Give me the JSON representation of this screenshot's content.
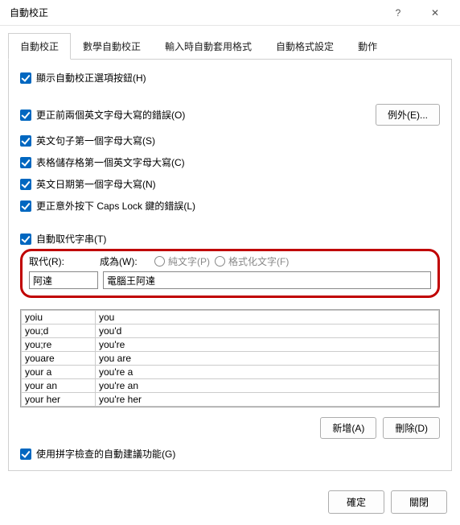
{
  "window": {
    "title": "自動校正",
    "help": "?",
    "close": "✕"
  },
  "tabs": [
    "自動校正",
    "數學自動校正",
    "輸入時自動套用格式",
    "自動格式設定",
    "動作"
  ],
  "checks": {
    "show_buttons": "顯示自動校正選項按鈕(H)",
    "two_caps": "更正前兩個英文字母大寫的錯誤(O)",
    "sentence_cap": "英文句子第一個字母大寫(S)",
    "table_cell_cap": "表格儲存格第一個英文字母大寫(C)",
    "day_cap": "英文日期第一個字母大寫(N)",
    "caps_lock": "更正意外按下 Caps Lock 鍵的錯誤(L)",
    "auto_replace": "自動取代字串(T)",
    "spell_suggest": "使用拼字檢查的自動建議功能(G)"
  },
  "exceptions_btn": "例外(E)...",
  "replace_header": {
    "replace": "取代(R):",
    "with": "成為(W):",
    "plain": "純文字(P)",
    "formatted": "格式化文字(F)"
  },
  "replace_input": {
    "from": "阿達",
    "to": "電腦王阿達"
  },
  "list": [
    {
      "from": "yoiu",
      "to": "you"
    },
    {
      "from": "you;d",
      "to": "you'd"
    },
    {
      "from": "you;re",
      "to": "you're"
    },
    {
      "from": "youare",
      "to": "you are"
    },
    {
      "from": "your a",
      "to": "you're a"
    },
    {
      "from": "your an",
      "to": "you're an"
    },
    {
      "from": "your her",
      "to": "you're her"
    }
  ],
  "btn_add": "新增(A)",
  "btn_delete": "刪除(D)",
  "btn_ok": "確定",
  "btn_close": "關閉"
}
